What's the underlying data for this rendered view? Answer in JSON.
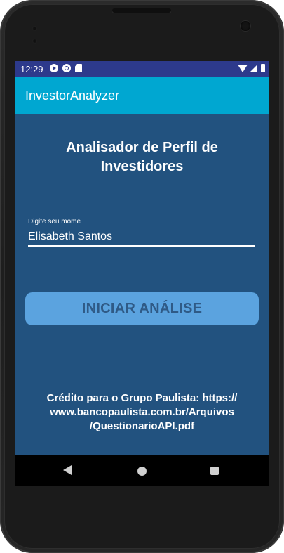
{
  "status_bar": {
    "time": "12:29"
  },
  "app_bar": {
    "title": "InvestorAnalyzer"
  },
  "main": {
    "heading_line1": "Analisador de Perfil de",
    "heading_line2": "Investidores",
    "name_field": {
      "label": "Digite seu mome",
      "value": "Elisabeth Santos"
    },
    "start_button": "INICIAR ANÁLISE",
    "credit_line1": "Crédito para o Grupo Paulista: https://",
    "credit_line2": "www.bancopaulista.com.br/Arquivos",
    "credit_line3": "/QuestionarioAPI.pdf"
  },
  "colors": {
    "status_bar": "#2d3a8c",
    "app_bar": "#00a7d1",
    "background": "#22527f",
    "button": "#5ba3df",
    "button_text": "#2f5a86"
  },
  "icons": {
    "status_left": [
      "play-circle-icon",
      "g-circle-icon",
      "sd-card-icon"
    ],
    "status_right": [
      "wifi-icon",
      "signal-icon",
      "battery-icon"
    ],
    "nav": [
      "back-icon",
      "home-icon",
      "recents-icon"
    ]
  }
}
